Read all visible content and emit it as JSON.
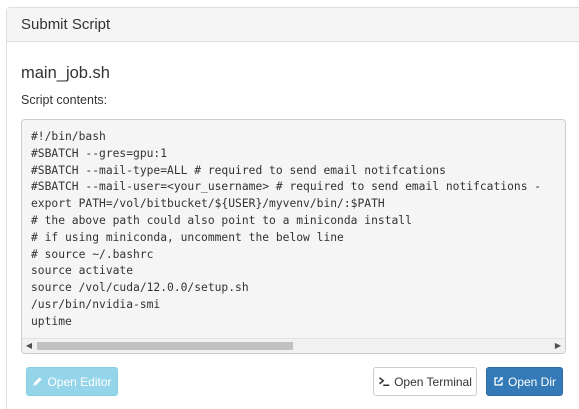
{
  "panel": {
    "heading": "Submit Script"
  },
  "script": {
    "filename": "main_job.sh",
    "contents_label": "Script contents:",
    "contents": "#!/bin/bash\n#SBATCH --gres=gpu:1\n#SBATCH --mail-type=ALL # required to send email notifcations\n#SBATCH --mail-user=<your_username> # required to send email notifcations - \nexport PATH=/vol/bitbucket/${USER}/myvenv/bin/:$PATH\n# the above path could also point to a miniconda install\n# if using miniconda, uncomment the below line\n# source ~/.bashrc\nsource activate\nsource /vol/cuda/12.0.0/setup.sh\n/usr/bin/nvidia-smi\nuptime"
  },
  "buttons": {
    "open_editor": {
      "label": "Open Editor",
      "icon": "pencil-icon",
      "color": "#5bc0de",
      "disabled": true
    },
    "open_terminal": {
      "label": "Open Terminal",
      "icon": "terminal-icon"
    },
    "open_dir": {
      "label": "Open Dir",
      "icon": "external-link-icon",
      "color": "#337ab7"
    }
  }
}
